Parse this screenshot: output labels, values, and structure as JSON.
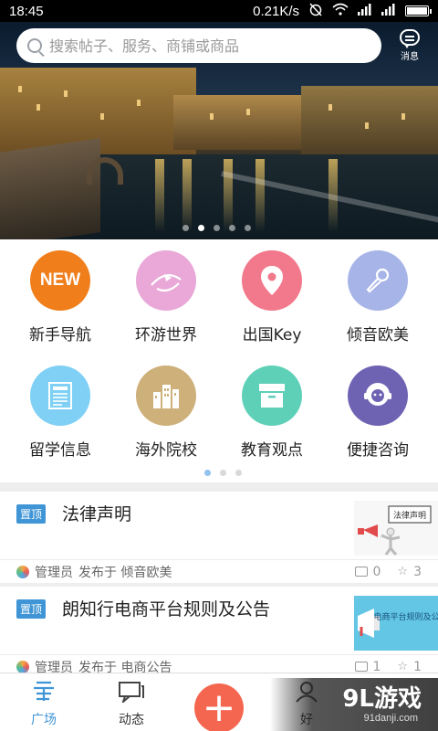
{
  "status_bar": {
    "time": "18:45",
    "speed": "0.21K/s"
  },
  "search": {
    "placeholder": "搜索帖子、服务、商铺或商品"
  },
  "header": {
    "message_label": "消息"
  },
  "banner": {
    "dot_count": 5,
    "active_dot": 1
  },
  "categories": [
    {
      "label": "新手导航",
      "icon": "new-badge-icon",
      "color": "#f07e1b",
      "icon_text": "NEW"
    },
    {
      "label": "环游世界",
      "icon": "plane-icon",
      "color": "#e9a8d8"
    },
    {
      "label": "出国Key",
      "icon": "location-pin-icon",
      "color": "#f2788b"
    },
    {
      "label": "倾音欧美",
      "icon": "microphone-icon",
      "color": "#a7b4e8"
    },
    {
      "label": "留学信息",
      "icon": "newspaper-icon",
      "color": "#7fd0f4"
    },
    {
      "label": "海外院校",
      "icon": "buildings-icon",
      "color": "#cdb07a"
    },
    {
      "label": "教育观点",
      "icon": "box-icon",
      "color": "#5fd0b8"
    },
    {
      "label": "便捷咨询",
      "icon": "support-agent-icon",
      "color": "#6e63b3"
    }
  ],
  "grid_pager": {
    "count": 3,
    "active": 0
  },
  "posts": [
    {
      "tag": "置顶",
      "title": "法律声明",
      "author": "管理员",
      "published_in": "发布于 倾音欧美",
      "comments": "0",
      "likes": "3",
      "thumb_text": "法律声明"
    },
    {
      "tag": "置顶",
      "title": "朗知行电商平台规则及公告",
      "author": "管理员",
      "published_in": "发布于 电商公告",
      "comments": "1",
      "likes": "1",
      "thumb_text": "电商平台规则及公告"
    }
  ],
  "tabbar": {
    "tabs": [
      {
        "label": "广场",
        "active": true,
        "color": "#3f95d6"
      },
      {
        "label": "动态",
        "active": false,
        "color": "#333333"
      },
      {
        "label": "好",
        "active": false,
        "color": "#333333"
      }
    ],
    "add_symbol": "+"
  },
  "watermark": {
    "logo": "9L游戏",
    "url": "91danji.com"
  },
  "colors": {
    "accent": "#3f95d6",
    "add_button": "#f4664f"
  }
}
